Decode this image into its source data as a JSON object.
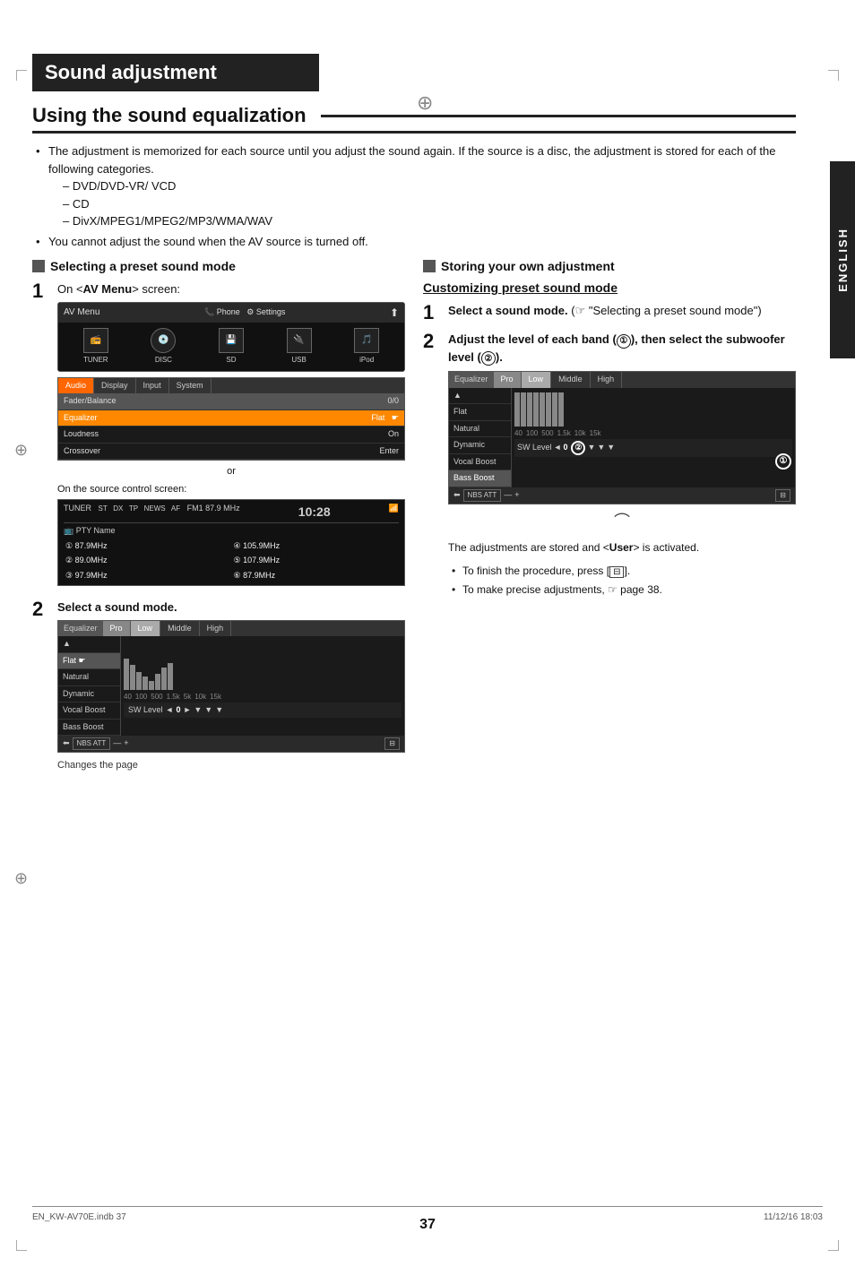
{
  "page": {
    "title": "Sound adjustment",
    "section_heading": "Using the sound equalization",
    "bullets": [
      "The adjustment is memorized for each source until you adjust the sound again. If the source is a disc, the adjustment is stored for each of the following categories.",
      "You cannot adjust the sound when the AV source is turned off."
    ],
    "sub_bullets": [
      "DVD/DVD-VR/ VCD",
      "CD",
      "DivX/MPEG1/MPEG2/MP3/WMA/WAV"
    ],
    "left_col": {
      "heading": "Selecting a preset sound mode",
      "step1_label": "1",
      "step1_text": "On <AV Menu> screen:",
      "step1_av_menu": "AV Menu",
      "step1_phone": "Phone",
      "step1_settings": "Settings",
      "step1_tuner": "TUNER",
      "step1_disc": "DISC",
      "step1_sd": "SD",
      "step1_usb": "USB",
      "step1_ipod": "iPod",
      "settings_heading": "Settings",
      "settings_tabs": [
        "Audio",
        "Display",
        "Input",
        "System"
      ],
      "settings_rows": [
        {
          "label": "Fader/Balance",
          "value": "0/0"
        },
        {
          "label": "Equalizer",
          "value": "Flat"
        },
        {
          "label": "Loudness",
          "value": "On"
        },
        {
          "label": "Crossover",
          "value": "Enter"
        }
      ],
      "or_text": "or",
      "source_control_label": "On the source control screen:",
      "tuner_label": "TUNER",
      "tuner_freq": "FM1 87.9 MHz",
      "tuner_time": "10:28",
      "tuner_pty": "PTY Name",
      "tuner_channels": [
        {
          "num": "1",
          "freq": "87.9MHz"
        },
        {
          "num": "4",
          "freq": "105.9MHz"
        },
        {
          "num": "2",
          "freq": "89.0MHz"
        },
        {
          "num": "5",
          "freq": "107.9MHz"
        },
        {
          "num": "3",
          "freq": "97.9MHz"
        },
        {
          "num": "6",
          "freq": "87.9MHz"
        }
      ],
      "step2_label": "2",
      "step2_text": "Select a sound mode.",
      "eq_label": "Equalizer",
      "eq_tabs": [
        "Pro",
        "Low",
        "Middle",
        "High"
      ],
      "eq_modes": [
        "Flat",
        "Natural",
        "Dynamic",
        "Vocal Boost",
        "Bass Boost"
      ],
      "eq_sw_level": "SW Level",
      "eq_sw_value": "0",
      "changes_page": "Changes the page"
    },
    "right_col": {
      "heading": "Storing your own adjustment",
      "customizing_heading": "Customizing preset sound mode",
      "step1_label": "1",
      "step1_bold": "Select a sound mode.",
      "step1_ref": "(☞ \"Selecting a preset sound mode\")",
      "step2_label": "2",
      "step2_bold_prefix": "Adjust the level of each band (",
      "step2_circle1": "①",
      "step2_bold_mid": "), then select the subwoofer level (",
      "step2_circle2": "②",
      "step2_bold_suffix": ").",
      "eq_label": "Equalizer",
      "eq_tabs": [
        "Pro",
        "Low",
        "Middle",
        "High"
      ],
      "eq_modes": [
        "Flat",
        "Natural",
        "Dynamic",
        "Vocal Boost",
        "Bass Boost"
      ],
      "eq_sw_level": "SW Level",
      "eq_sw_value": "0",
      "activated_text": "The adjustments are stored and <User> is activated.",
      "footnotes": [
        "To finish the procedure, press [   ].",
        "To make precise adjustments, ☞ page 38."
      ]
    },
    "page_number": "37",
    "footer_left": "EN_KW-AV70E.indb   37",
    "footer_right": "11/12/16   18:03"
  }
}
